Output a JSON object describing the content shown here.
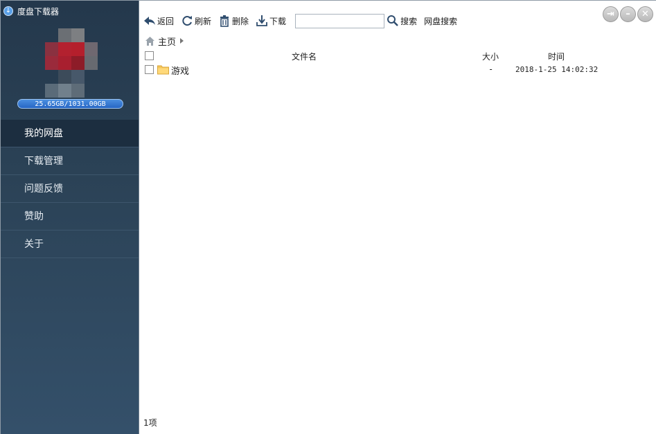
{
  "app": {
    "title": "度盘下载器",
    "icon": "download-arrow-icon"
  },
  "account": {
    "quota": "25.65GB/1031.00GB"
  },
  "sidebar": {
    "items": [
      {
        "label": "我的网盘",
        "active": true
      },
      {
        "label": "下载管理",
        "active": false
      },
      {
        "label": "问题反馈",
        "active": false
      },
      {
        "label": "赞助",
        "active": false
      },
      {
        "label": "关于",
        "active": false
      }
    ]
  },
  "toolbar": {
    "back_label": "返回",
    "refresh_label": "刷新",
    "delete_label": "删除",
    "download_label": "下载",
    "search_value": "",
    "search_label": "搜索",
    "netdisk_search_label": "网盘搜索"
  },
  "breadcrumb": {
    "home_label": "主页"
  },
  "table": {
    "columns": {
      "name": "文件名",
      "size": "大小",
      "time": "时间"
    },
    "rows": [
      {
        "name": "游戏",
        "size": "-",
        "time": "2018-1-25 14:02:32",
        "type": "folder"
      }
    ]
  },
  "status": {
    "count": "1项"
  },
  "colors": {
    "sidebar_bg": "#2b4256",
    "active_nav": "#1c2e40",
    "quota_bar": "#2766c4",
    "folder": "#f5c65a"
  }
}
